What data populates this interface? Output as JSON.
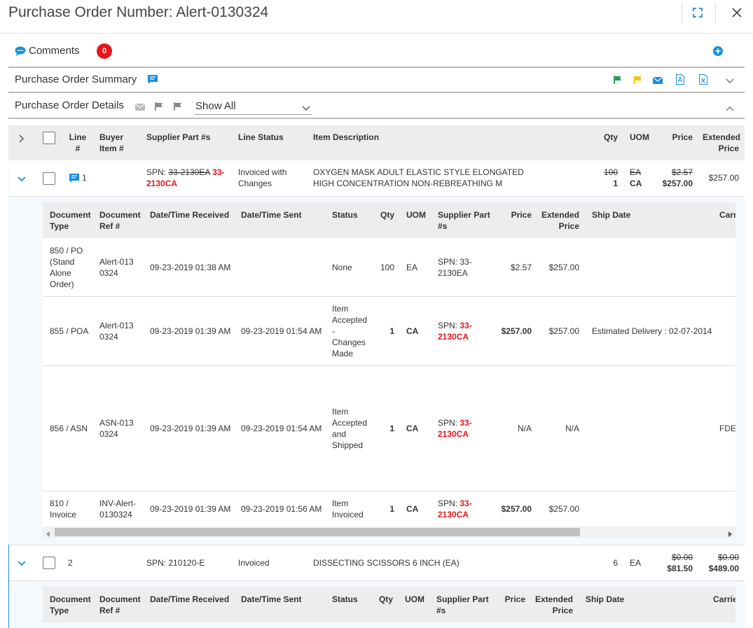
{
  "title": "Purchase Order Number: Alert-0130324",
  "comments": {
    "label": "Comments",
    "count": "0"
  },
  "summary": {
    "label": "Purchase Order Summary"
  },
  "details": {
    "label": "Purchase Order Details",
    "filter": "Show All"
  },
  "table": {
    "headers": {
      "line": "Line #",
      "buyer_item": "Buyer Item #",
      "supplier_part": "Supplier Part #s",
      "line_status": "Line Status",
      "item_desc": "Item Description",
      "qty": "Qty",
      "uom": "UOM",
      "price": "Price",
      "ext_price": "Extended Price"
    },
    "rows": [
      {
        "line": "1",
        "spn_prefix": "SPN: ",
        "spn_old": "33-2130EA",
        "spn_new": "33-2130CA",
        "status": "Invoiced with Changes",
        "desc": "OXYGEN MASK  ADULT  ELASTIC STYLE ELONGATED HIGH CONCENTRATION NON-REBREATHING M",
        "qty_old": "100",
        "qty_new": "1",
        "uom_old": "EA",
        "uom_new": "CA",
        "price_old": "$2.57",
        "price_new": "$257.00",
        "ext": "$257.00"
      },
      {
        "line": "2",
        "spn": "SPN: 210120-E",
        "status": "Invoiced",
        "desc": "DISSECTING SCISSORS 6 INCH (EA)",
        "qty": "6",
        "uom": "EA",
        "price_old": "$0.00",
        "price_new": "$81.50",
        "ext_old": "$0.00",
        "ext_new": "$489.00"
      }
    ]
  },
  "doc_table": {
    "headers": {
      "doc_type": "Document Type",
      "doc_ref": "Document Ref #",
      "received": "Date/Time Received",
      "sent": "Date/Time Sent",
      "status": "Status",
      "qty": "Qty",
      "uom": "UOM",
      "supplier_part": "Supplier Part #s",
      "price": "Price",
      "ext_price": "Extended Price",
      "ship_date": "Ship Date",
      "carrier": "Carrier"
    },
    "rows": [
      {
        "type": "850 / PO (Stand Alone Order)",
        "ref": "Alert-0130324",
        "received": "09-23-2019 01:38 AM",
        "sent": "",
        "status": "None",
        "qty": "100",
        "uom": "EA",
        "spn_prefix": "SPN: ",
        "spn": "33-2130EA",
        "price": "$2.57",
        "ext": "$257.00",
        "ship": "",
        "carrier": ""
      },
      {
        "type": "855 / POA",
        "ref": "Alert-0130324",
        "received": "09-23-2019 01:39 AM",
        "sent": "09-23-2019 01:54 AM",
        "status": "Item Accepted - Changes Made",
        "qty": "1",
        "uom": "CA",
        "spn_prefix": "SPN: ",
        "spn": "33-2130CA",
        "price": "$257.00",
        "ext": "$257.00",
        "ship": "Estimated Delivery : 02-07-2014",
        "carrier": ""
      },
      {
        "type": "856 / ASN",
        "ref": "ASN-0130324",
        "received": "09-23-2019 01:39 AM",
        "sent": "09-23-2019 01:54 AM",
        "status": "Item Accepted and Shipped",
        "qty": "1",
        "uom": "CA",
        "spn_prefix": "SPN: ",
        "spn": "33-2130CA",
        "price": "N/A",
        "ext": "N/A",
        "ship": "",
        "carrier": "FDEN"
      },
      {
        "type": "810 / Invoice",
        "ref": "INV-Alert-0130324",
        "received": "09-23-2019 01:39 AM",
        "sent": "09-23-2019 01:56 AM",
        "status": "Item Invoiced",
        "qty": "1",
        "uom": "CA",
        "spn_prefix": "SPN: ",
        "spn": "33-2130CA",
        "price": "$257.00",
        "ext": "$257.00",
        "ship": "",
        "carrier": ""
      }
    ]
  },
  "doc_table2": {
    "headers": {
      "doc_type": "Document Type",
      "doc_ref": "Document Ref #",
      "received": "Date/Time Received",
      "sent": "Date/Time Sent",
      "status": "Status",
      "qty": "Qty",
      "uom": "UOM",
      "supplier_part": "Supplier Part #s",
      "price": "Price",
      "ext_price": "Extended Price",
      "ship_date": "Ship Date",
      "carrier": "Carrie"
    }
  },
  "colors": {
    "accent": "#1a8fdb",
    "red": "#e8151b",
    "flag_green": "#1e9c4b",
    "flag_yellow": "#f4c300"
  }
}
